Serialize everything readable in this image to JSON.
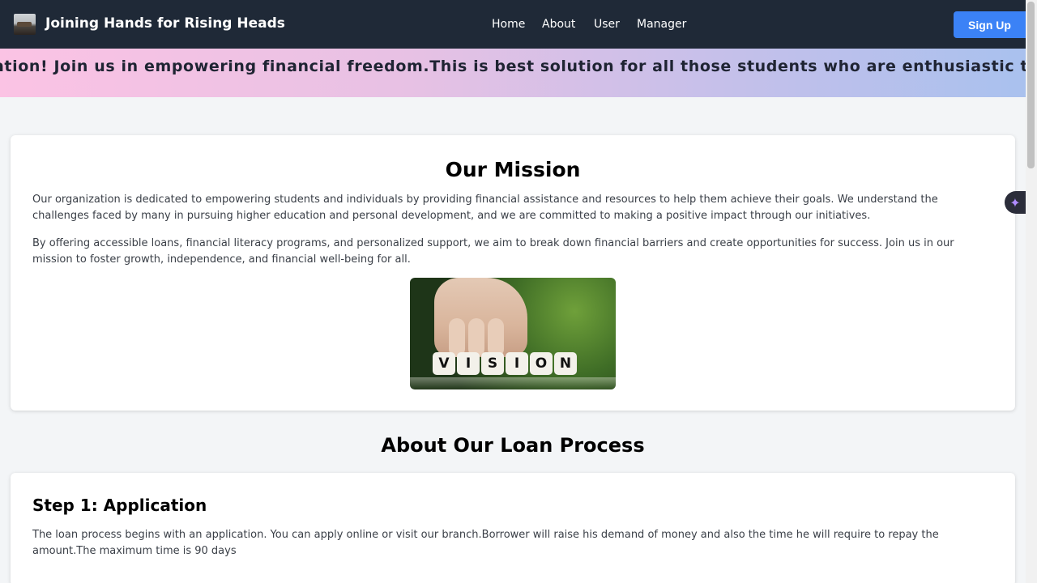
{
  "nav": {
    "brand": "Joining Hands for Rising Heads",
    "links": [
      "Home",
      "About",
      "User",
      "Manager"
    ],
    "signup": "Sign Up"
  },
  "banner": {
    "text": "ation! Join us in empowering financial freedom.This is best solution for all those students who are enthusiastic to start the"
  },
  "mission": {
    "title": "Our Mission",
    "paragraphs": [
      "Our organization is dedicated to empowering students and individuals by providing financial assistance and resources to help them achieve their goals. We understand the challenges faced by many in pursuing higher education and personal development, and we are committed to making a positive impact through our initiatives.",
      "By offering accessible loans, financial literacy programs, and personalized support, we aim to break down financial barriers and create opportunities for success. Join us in our mission to foster growth, independence, and financial well-being for all."
    ],
    "image_dice": [
      "V",
      "I",
      "S",
      "I",
      "O",
      "N"
    ]
  },
  "loan": {
    "title": "About Our Loan Process",
    "step1": {
      "title": "Step 1: Application",
      "text": "The loan process begins with an application. You can apply online or visit our branch.Borrower will raise his demand of money and also the time he will require to repay the amount.The maximum time is 90 days"
    }
  },
  "icons": {
    "logo": "logo-image-icon",
    "ai_assistant": "sparkle-icon"
  },
  "colors": {
    "navbar": "#1f2937",
    "signup": "#3b82f6",
    "banner_start": "#fbc3e4",
    "banner_end": "#a9c1ee"
  }
}
